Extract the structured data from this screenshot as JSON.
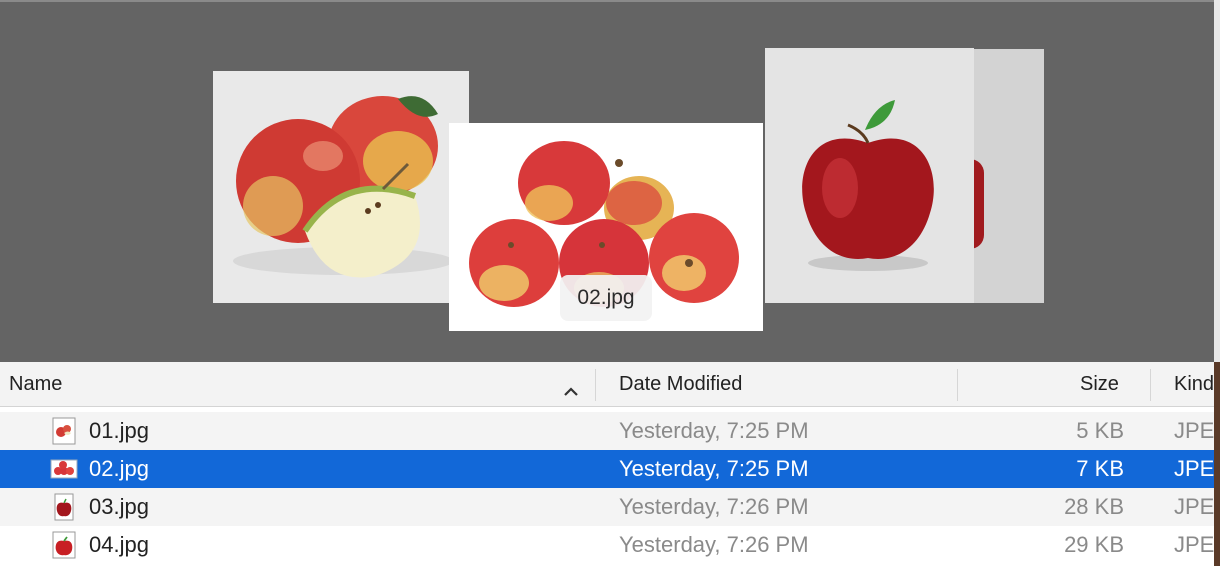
{
  "coverflow": {
    "caption": "02.jpg",
    "cards": [
      {
        "name": "01.jpg",
        "subject": "apples-with-slice"
      },
      {
        "name": "02.jpg",
        "subject": "apple-pile"
      },
      {
        "name": "03.jpg",
        "subject": "single-red-apple"
      }
    ]
  },
  "list": {
    "columns": {
      "name": "Name",
      "date": "Date Modified",
      "size": "Size",
      "kind": "Kind"
    },
    "sort_indicator": "ascending",
    "rows": [
      {
        "name": "01.jpg",
        "date": "Yesterday, 7:25 PM",
        "size": "5 KB",
        "kind": "JPE",
        "selected": false
      },
      {
        "name": "02.jpg",
        "date": "Yesterday, 7:25 PM",
        "size": "7 KB",
        "kind": "JPE",
        "selected": true
      },
      {
        "name": "03.jpg",
        "date": "Yesterday, 7:26 PM",
        "size": "28 KB",
        "kind": "JPE",
        "selected": false
      },
      {
        "name": "04.jpg",
        "date": "Yesterday, 7:26 PM",
        "size": "29 KB",
        "kind": "JPE",
        "selected": false
      }
    ]
  },
  "colors": {
    "coverflow_bg": "#646464",
    "selection": "#1268d8",
    "header_bg": "#f3f3f3"
  }
}
